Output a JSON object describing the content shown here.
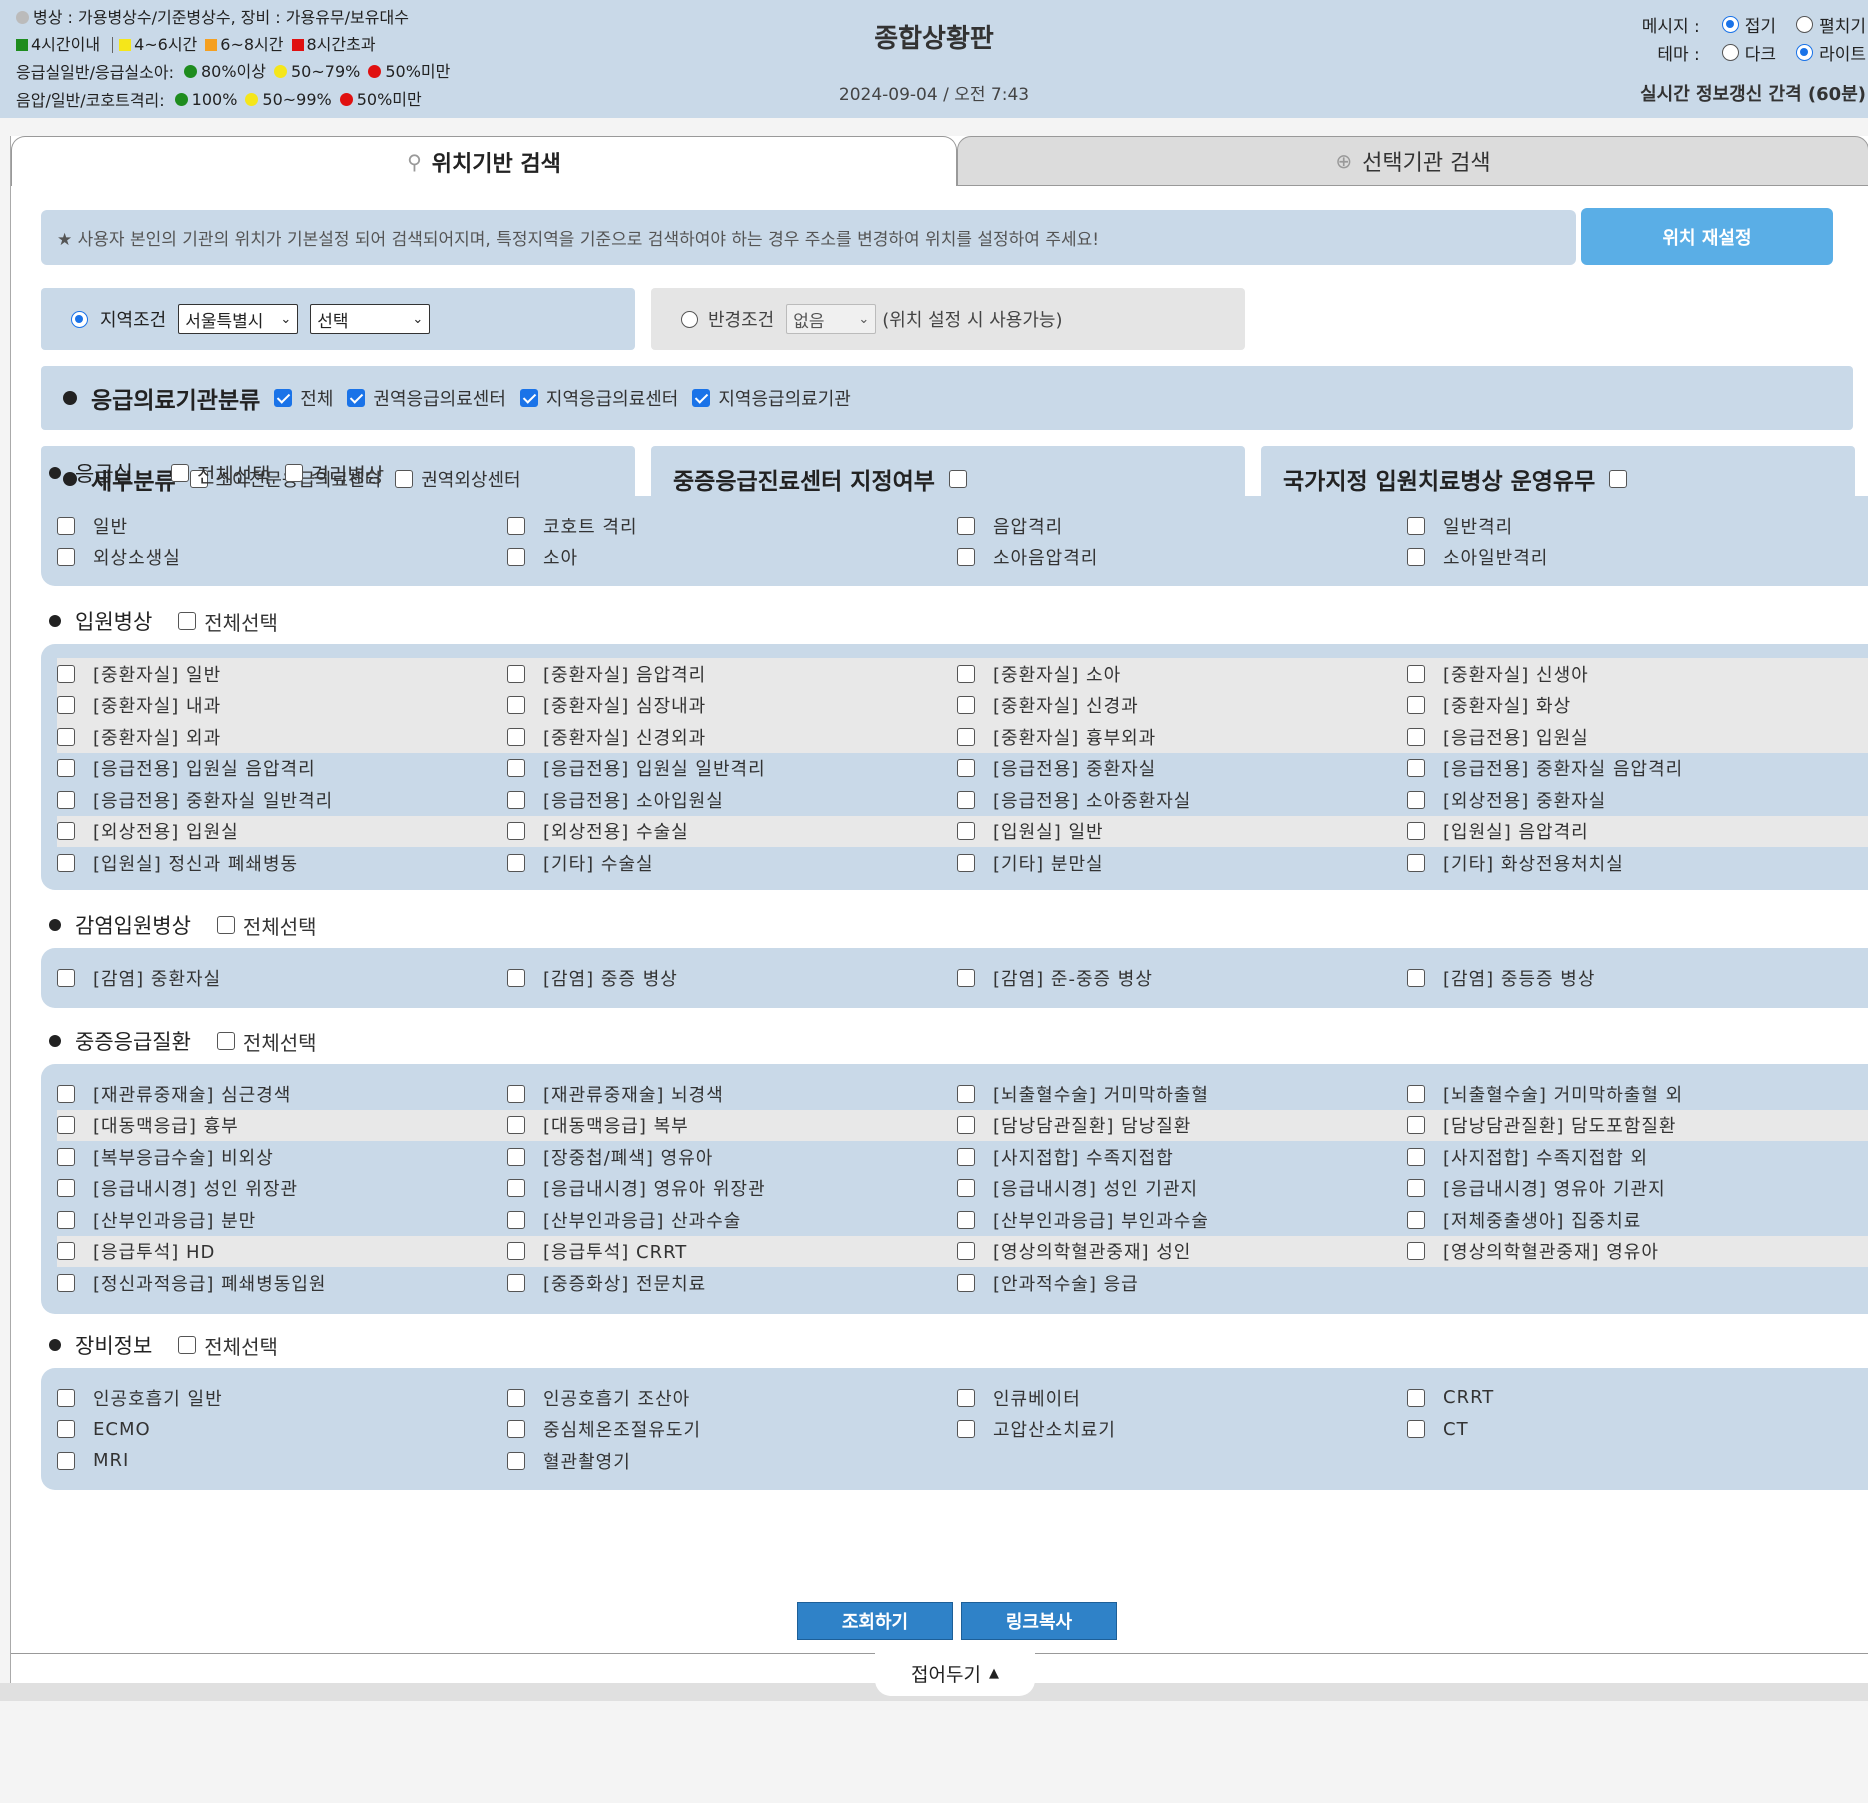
{
  "header": {
    "legend_line1": "병상 : 가용병상수/기준병상수, 장비 : 가용유무/보유대수",
    "time_legend": [
      {
        "label": "4시간이내",
        "color": "#1e8c1e"
      },
      {
        "label": "4~6시간",
        "color": "#f5e61a"
      },
      {
        "label": "6~8시간",
        "color": "#f5a020"
      },
      {
        "label": "8시간초과",
        "color": "#e01010"
      }
    ],
    "er_label": "응급실일반/응급실소아:",
    "er_levels": [
      {
        "label": "80%이상",
        "color": "#1e8c1e"
      },
      {
        "label": "50~79%",
        "color": "#f5e61a"
      },
      {
        "label": "50%미만",
        "color": "#e01010"
      }
    ],
    "iso_label": "음압/일반/코호트격리:",
    "iso_levels": [
      {
        "label": "100%",
        "color": "#1e8c1e"
      },
      {
        "label": "50~99%",
        "color": "#f5e61a"
      },
      {
        "label": "50%미만",
        "color": "#e01010"
      }
    ],
    "title": "종합상황판",
    "datetime": "2024-09-04 / 오전 7:43",
    "message_label": "메시지 :",
    "message_opt1": "접기",
    "message_opt2": "펼치기",
    "theme_label": "테마 :",
    "theme_opt1": "다크",
    "theme_opt2": "라이트",
    "refresh_text": "실시간 정보갱신 간격 (60분)"
  },
  "tabs": {
    "location": "위치기반 검색",
    "selected": "선택기관 검색"
  },
  "notice": "★ 사용자 본인의 기관의 위치가 기본설정 되어 검색되어지며, 특정지역을 기준으로 검색하여야 하는 경우 주소를 변경하여 위치를 설정하여 주세요!",
  "relocate_button": "위치 재설정",
  "conditions": {
    "region_label": "지역조건",
    "region_select1": "서울특별시",
    "region_select2": "선택",
    "radius_label": "반경조건",
    "radius_select": "없음",
    "radius_note": "(위치 설정 시 사용가능)"
  },
  "classification": {
    "label": "응급의료기관분류",
    "options": [
      "전체",
      "권역응급의료센터",
      "지역응급의료센터",
      "지역응급의료기관"
    ]
  },
  "subclass": {
    "label": "세부분류",
    "options": [
      "소아전문응급의료센터",
      "권역외상센터"
    ],
    "severe_center": "중증응급진료센터 지정여부",
    "national_bed": "국가지정 입원치료병상 운영유무"
  },
  "er": {
    "label": "응급실",
    "select_all": "전체선택",
    "isolation": "격리병상",
    "items": [
      "일반",
      "코호트 격리",
      "음압격리",
      "일반격리",
      "외상소생실",
      "소아",
      "소아음압격리",
      "소아일반격리"
    ]
  },
  "inpatient": {
    "label": "입원병상",
    "select_all": "전체선택",
    "items": [
      "[중환자실] 일반",
      "[중환자실] 음압격리",
      "[중환자실] 소아",
      "[중환자실] 신생아",
      "[중환자실] 내과",
      "[중환자실] 심장내과",
      "[중환자실] 신경과",
      "[중환자실] 화상",
      "[중환자실] 외과",
      "[중환자실] 신경외과",
      "[중환자실] 흉부외과",
      "[응급전용] 입원실",
      "[응급전용] 입원실 음압격리",
      "[응급전용] 입원실 일반격리",
      "[응급전용] 중환자실",
      "[응급전용] 중환자실 음압격리",
      "[응급전용] 중환자실 일반격리",
      "[응급전용] 소아입원실",
      "[응급전용] 소아중환자실",
      "[외상전용] 중환자실",
      "[외상전용] 입원실",
      "[외상전용] 수술실",
      "[입원실] 일반",
      "[입원실] 음압격리",
      "[입원실] 정신과 폐쇄병동",
      "[기타] 수술실",
      "[기타] 분만실",
      "[기타] 화상전용처치실"
    ]
  },
  "infection": {
    "label": "감염입원병상",
    "select_all": "전체선택",
    "items": [
      "[감염] 중환자실",
      "[감염] 중증 병상",
      "[감염] 준-중증 병상",
      "[감염] 중등증 병상"
    ]
  },
  "severe": {
    "label": "중증응급질환",
    "select_all": "전체선택",
    "items": [
      "[재관류중재술] 심근경색",
      "[재관류중재술] 뇌경색",
      "[뇌출혈수술] 거미막하출혈",
      "[뇌출혈수술] 거미막하출혈 외",
      "[대동맥응급] 흉부",
      "[대동맥응급] 복부",
      "[담낭담관질환] 담낭질환",
      "[담낭담관질환] 담도포함질환",
      "[복부응급수술] 비외상",
      "[장중첩/폐색] 영유아",
      "[사지접합] 수족지접합",
      "[사지접합] 수족지접합 외",
      "[응급내시경] 성인 위장관",
      "[응급내시경] 영유아 위장관",
      "[응급내시경] 성인 기관지",
      "[응급내시경] 영유아 기관지",
      "[산부인과응급] 분만",
      "[산부인과응급] 산과수술",
      "[산부인과응급] 부인과수술",
      "[저체중출생아] 집중치료",
      "[응급투석] HD",
      "[응급투석] CRRT",
      "[영상의학혈관중재] 성인",
      "[영상의학혈관중재] 영유아",
      "[정신과적응급] 폐쇄병동입원",
      "[중증화상] 전문치료",
      "[안과적수술] 응급"
    ]
  },
  "equipment": {
    "label": "장비정보",
    "select_all": "전체선택",
    "items": [
      "인공호흡기 일반",
      "인공호흡기 조산아",
      "인큐베이터",
      "CRRT",
      "ECMO",
      "중심체온조절유도기",
      "고압산소치료기",
      "CT",
      "MRI",
      "혈관촬영기"
    ]
  },
  "buttons": {
    "search": "조회하기",
    "copy_link": "링크복사"
  },
  "fold": "접어두기"
}
